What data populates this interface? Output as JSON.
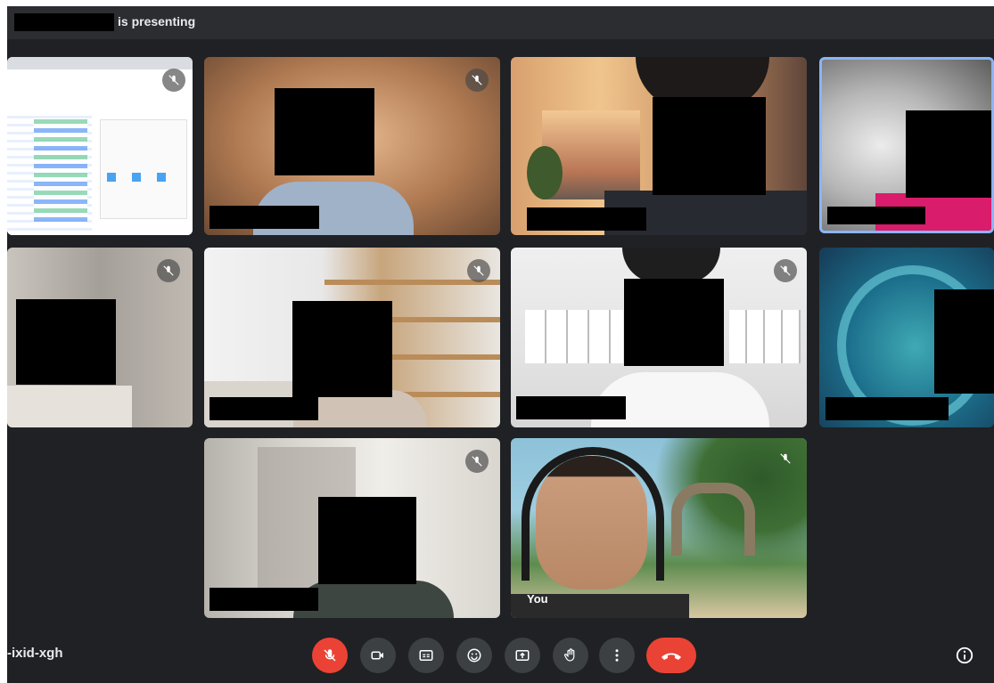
{
  "header": {
    "presenting_text": "is presenting"
  },
  "tiles": {
    "self_label": "You"
  },
  "footer": {
    "meeting_code": "-ixid-xgh"
  },
  "controls": [
    {
      "name": "mic-off-button",
      "icon": "mic-off-icon"
    },
    {
      "name": "camera-button",
      "icon": "camera-icon"
    },
    {
      "name": "captions-button",
      "icon": "captions-icon"
    },
    {
      "name": "emoji-button",
      "icon": "emoji-icon"
    },
    {
      "name": "present-button",
      "icon": "present-screen-icon"
    },
    {
      "name": "raise-hand-button",
      "icon": "hand-icon"
    },
    {
      "name": "more-options-button",
      "icon": "more-vert-icon"
    },
    {
      "name": "end-call-button",
      "icon": "phone-hangup-icon"
    },
    {
      "name": "info-button",
      "icon": "info-icon"
    }
  ],
  "colors": {
    "background": "#202124",
    "header": "#2c2d30",
    "control": "#3c4043",
    "danger": "#ea4335",
    "active_border": "#8ab4f8"
  }
}
